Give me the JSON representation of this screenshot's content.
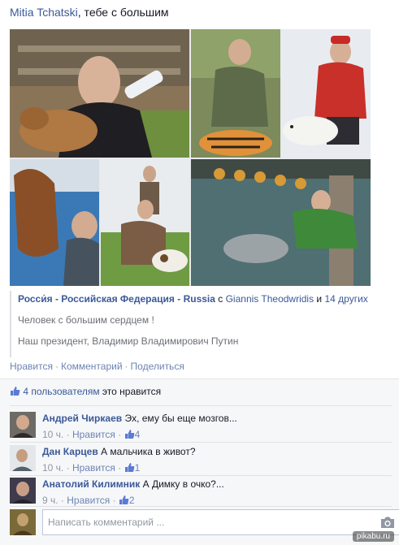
{
  "post": {
    "author": "Mitia Tchatski",
    "headline_rest": ", тебе с большим"
  },
  "shared": {
    "page_name": "Росси́я - Российская Федерация - Russia",
    "with_word": " с ",
    "tagged_person": "Giannis Theodwridis",
    "and_word": " и ",
    "others": "14 других",
    "line1": "Человек с большим сердцем !",
    "line2": "Наш президент, Владимир Владимирович Путин"
  },
  "actions": {
    "like": "Нравится",
    "comment": "Комментарий",
    "share": "Поделиться",
    "separator": "·"
  },
  "ufi": {
    "likes_link": "4 пользователям",
    "likes_rest": " это нравится",
    "comments": [
      {
        "name": "Андрей Чиркаев",
        "text": "Эх, ему бы еще мозгов...",
        "time": "10 ч.",
        "like": "Нравится",
        "count": "4"
      },
      {
        "name": "Дан Карцев",
        "text": "А мальчика в живот?",
        "time": "10 ч.",
        "like": "Нравится",
        "count": "1"
      },
      {
        "name": "Анатолий Килимник",
        "text": "А Димку в очко?...",
        "time": "9 ч.",
        "like": "Нравится",
        "count": "2"
      }
    ],
    "composer_placeholder": "Написать комментарий ..."
  },
  "watermark": "pikabu.ru",
  "colors": {
    "link": "#3b5998",
    "muted_link": "#6d84b4",
    "ufi_bg": "#f6f7f9"
  },
  "icons": [
    "thumbs-up-icon",
    "camera-icon"
  ]
}
